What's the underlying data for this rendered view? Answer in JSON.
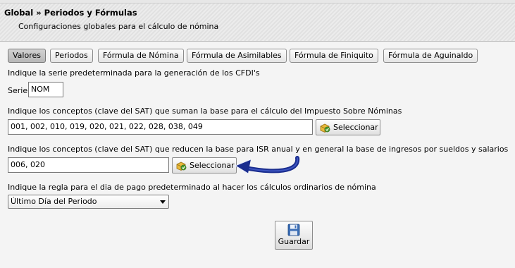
{
  "header": {
    "title": "Global » Periodos y Fórmulas",
    "subtitle": "Configuraciones globales para el cálculo de nómina"
  },
  "tabs": [
    {
      "label": "Valores"
    },
    {
      "label": "Periodos"
    },
    {
      "label": "Fórmula de Nómina"
    },
    {
      "label": "Fórmula de Asimilables"
    },
    {
      "label": "Fórmula de Finiquito"
    },
    {
      "label": "Fórmula de Aguinaldo"
    }
  ],
  "active_tab": "Valores",
  "serie": {
    "instruction": "Indique la serie predeterminada para la generación de los CFDI's",
    "label": "Serie",
    "value": "NOM"
  },
  "isn": {
    "instruction": "Indique los conceptos (clave del SAT) que suman la base para el cálculo del Impuesto Sobre Nóminas",
    "value": "001, 002, 010, 019, 020, 021, 022, 028, 038, 049",
    "button": "Seleccionar"
  },
  "isr": {
    "instruction": "Indique los conceptos (clave del SAT) que reducen la base para ISR anual y en general la base de ingresos por sueldos y salarios",
    "value": "006, 020",
    "button": "Seleccionar"
  },
  "pago": {
    "instruction": "Indique la regla para el dia de pago predeterminado al hacer los cálculos ordinarios de nómina",
    "selected": "Último Día del Periodo"
  },
  "save_button": "Guardar",
  "colors": {
    "annotation_arrow": "#1a2d8f",
    "icon_yellow": "#e8b93a",
    "icon_green": "#4a9a2e",
    "floppy_blue": "#3d6fb6"
  },
  "icons": {
    "select_button_icon": "package-add-icon",
    "save_button_icon": "floppy-disk-icon",
    "dropdown_icon": "chevron-down-icon",
    "annotation": "arrow-left-icon"
  }
}
